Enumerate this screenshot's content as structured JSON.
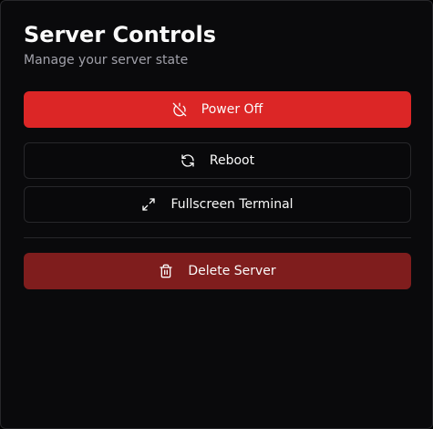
{
  "header": {
    "title": "Server Controls",
    "subtitle": "Manage your server state"
  },
  "actions": {
    "power_off": {
      "label": "Power Off",
      "icon": "power-off-icon"
    },
    "reboot": {
      "label": "Reboot",
      "icon": "refresh-icon"
    },
    "fullscreen_terminal": {
      "label": "Fullscreen Terminal",
      "icon": "expand-icon"
    },
    "delete_server": {
      "label": "Delete Server",
      "icon": "trash-icon"
    }
  },
  "colors": {
    "panel_bg": "#0a0a0c",
    "border": "#27272a",
    "danger": "#dc2626",
    "danger_dark": "#7f1d1d",
    "text": "#fafafa",
    "muted_text": "#a1a1aa"
  }
}
